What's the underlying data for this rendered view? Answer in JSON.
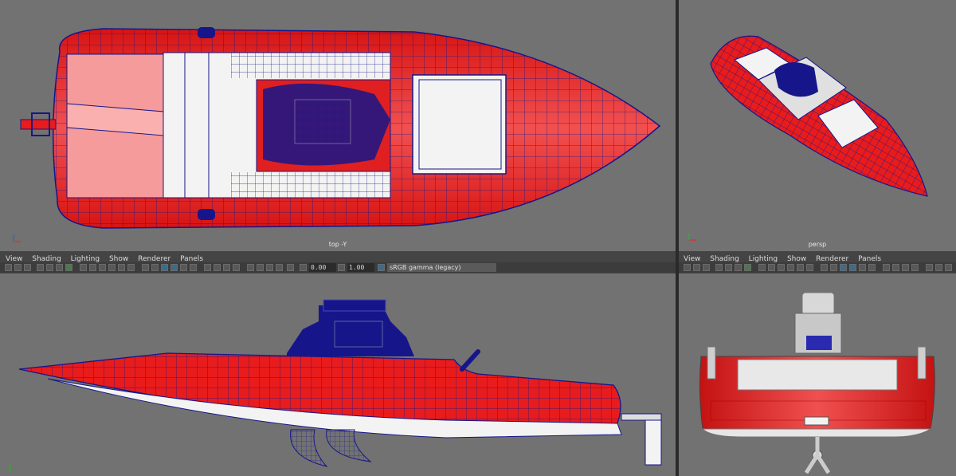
{
  "viewports": {
    "top": {
      "label": "top -Y"
    },
    "persp": {
      "label": "persp"
    }
  },
  "menus": {
    "left": [
      "View",
      "Shading",
      "Lighting",
      "Show",
      "Renderer",
      "Panels"
    ],
    "right": [
      "View",
      "Shading",
      "Lighting",
      "Show",
      "Renderer",
      "Panels"
    ]
  },
  "toolbar": {
    "near_clip": "0.00",
    "gamma": "1.00",
    "color_space": "sRGB gamma (legacy)"
  },
  "colors": {
    "hull": "#e81c1c",
    "wire": "#16168a",
    "deck": "#f3f3f3",
    "viewport_bg": "#727272"
  }
}
